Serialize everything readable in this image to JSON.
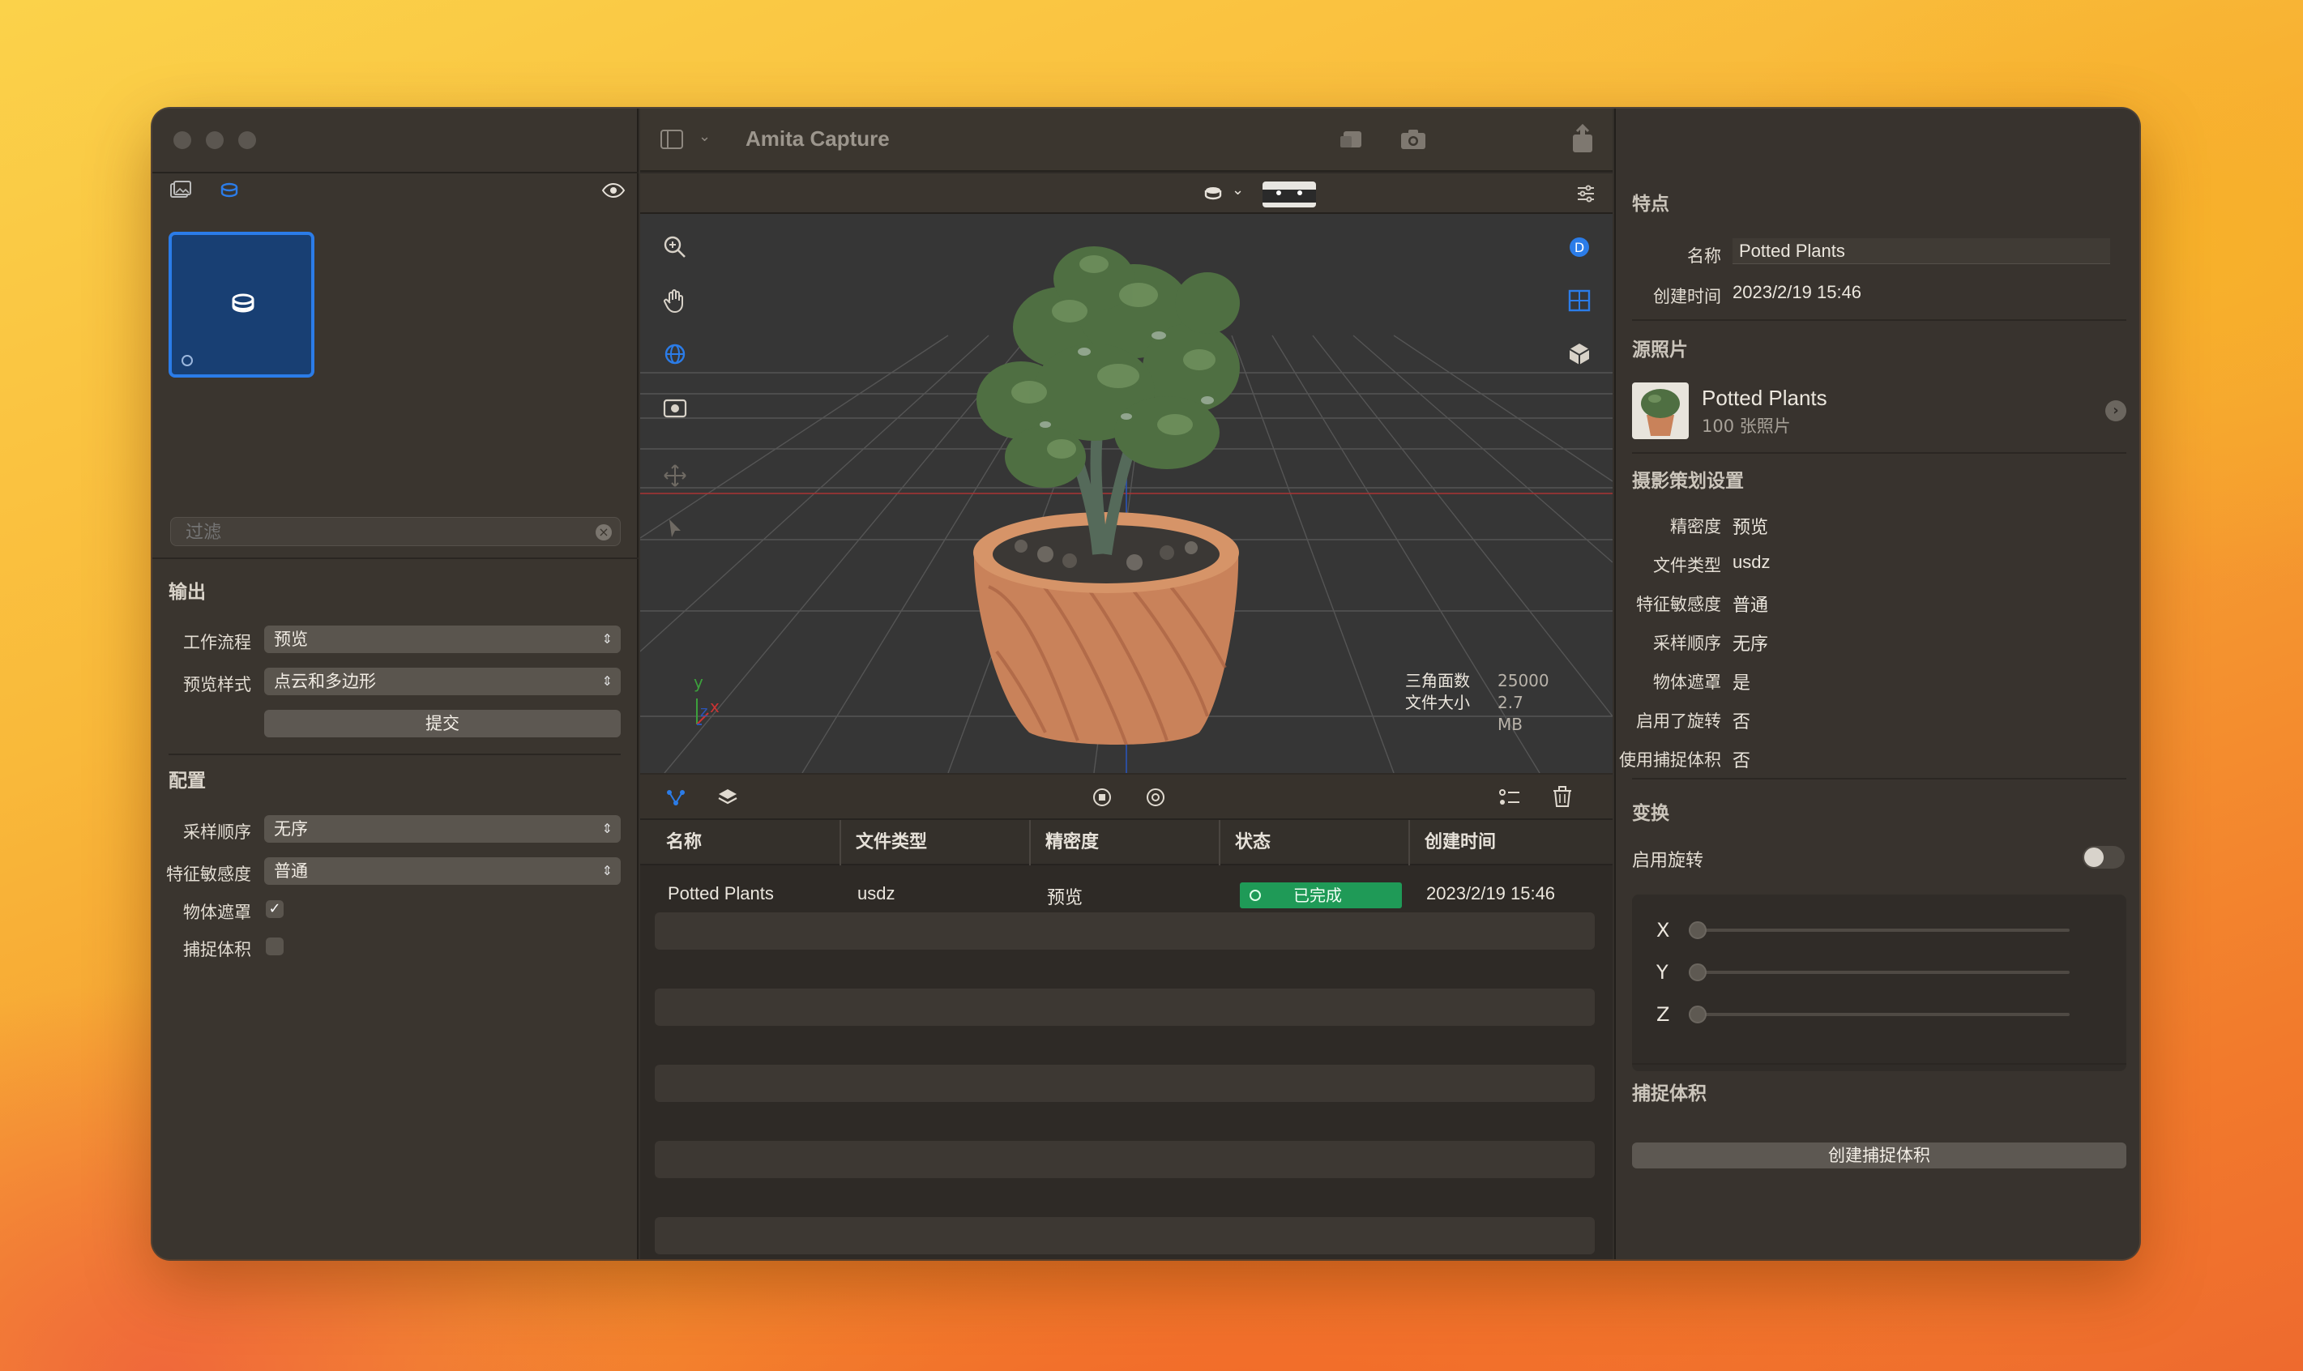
{
  "app": {
    "title": "Amita Capture"
  },
  "sidebar": {
    "filter_placeholder": "过滤",
    "output": {
      "title": "输出",
      "workflow_label": "工作流程",
      "workflow_value": "预览",
      "preview_style_label": "预览样式",
      "preview_style_value": "点云和多边形",
      "submit_label": "提交"
    },
    "config": {
      "title": "配置",
      "sample_order_label": "采样顺序",
      "sample_order_value": "无序",
      "feature_sensitivity_label": "特征敏感度",
      "feature_sensitivity_value": "普通",
      "object_mask_label": "物体遮罩",
      "object_mask_checked": true,
      "capture_volume_label": "捕捉体积",
      "capture_volume_checked": false
    }
  },
  "viewport": {
    "stats": {
      "triangles_label": "三角面数",
      "triangles_value": "25000",
      "filesize_label": "文件大小",
      "filesize_value": "2.7 MB"
    },
    "axis": {
      "x": "x",
      "y": "y",
      "z": "z"
    }
  },
  "table": {
    "columns": [
      "名称",
      "文件类型",
      "精密度",
      "状态",
      "创建时间"
    ],
    "rows": [
      {
        "name": "Potted Plants",
        "type": "usdz",
        "precision": "预览",
        "status": "已完成",
        "created": "2023/2/19 15:46"
      }
    ]
  },
  "inspector": {
    "features": {
      "title": "特点",
      "name_label": "名称",
      "name_value": "Potted Plants",
      "created_label": "创建时间",
      "created_value": "2023/2/19 15:46"
    },
    "source": {
      "title": "源照片",
      "name": "Potted Plants",
      "count": "100 张照片"
    },
    "settings": {
      "title": "摄影策划设置",
      "items": [
        {
          "label": "精密度",
          "value": "预览"
        },
        {
          "label": "文件类型",
          "value": "usdz"
        },
        {
          "label": "特征敏感度",
          "value": "普通"
        },
        {
          "label": "采样顺序",
          "value": "无序"
        },
        {
          "label": "物体遮罩",
          "value": "是"
        },
        {
          "label": "启用了旋转",
          "value": "否"
        },
        {
          "label": "使用捕捉体积",
          "value": "否"
        }
      ]
    },
    "transform": {
      "title": "变换",
      "rotation_label": "启用旋转",
      "rotation_enabled": false,
      "axes": [
        "X",
        "Y",
        "Z"
      ]
    },
    "capture_volume": {
      "title": "捕捉体积",
      "button_label": "创建捕捉体积"
    }
  },
  "colors": {
    "accent": "#2b7ce8",
    "status_green": "#1f9a57",
    "window_bg": "#34302b"
  }
}
